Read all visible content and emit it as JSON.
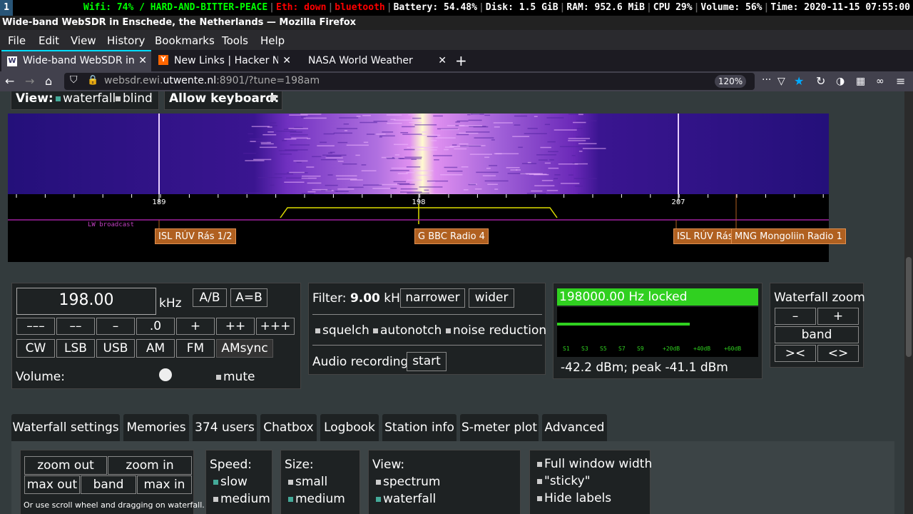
{
  "statusbar": {
    "workspace": "1",
    "items": [
      {
        "text": "Wifi:  74% / HARD-AND-BITTER-PEACE",
        "color": "#00ff00"
      },
      {
        "text": "Eth: down",
        "color": "#ff0000"
      },
      {
        "text": "bluetooth",
        "color": "#ff0000"
      },
      {
        "text": "Battery: 54.48%",
        "color": "#ffffff"
      },
      {
        "text": "Disk: 1.5 GiB",
        "color": "#ffffff"
      },
      {
        "text": "RAM: 952.6 MiB",
        "color": "#ffffff"
      },
      {
        "text": "CPU 29%",
        "color": "#ffffff"
      },
      {
        "text": "Volume: 56%",
        "color": "#ffffff"
      },
      {
        "text": "Time: 2020-11-15 07:55:00",
        "color": "#ffffff"
      }
    ]
  },
  "window_title": "Wide-band WebSDR in Enschede, the Netherlands — Mozilla Firefox",
  "menu": [
    "File",
    "Edit",
    "View",
    "History",
    "Bookmarks",
    "Tools",
    "Help"
  ],
  "tabs": [
    {
      "label": "Wide-band WebSDR in Enschede",
      "active": true
    },
    {
      "label": "New Links | Hacker News",
      "active": false
    },
    {
      "label": "NASA World Weather",
      "active": false
    }
  ],
  "url": {
    "prefix": "websdr.ewi.",
    "domain": "utwente.nl",
    "suffix": ":8901/?tune=198am",
    "zoom": "120%"
  },
  "view": {
    "label": "View:",
    "opt1": "waterfall",
    "opt2": "blind",
    "keyboard_label": "Allow keyboard:"
  },
  "scale": {
    "ticks": [
      "189",
      "198",
      "207"
    ],
    "band": "LW broadcast"
  },
  "stations": [
    "ISL RÚV Rás 1/2",
    "G BBC Radio 4",
    "ISL RÚV Rás",
    "MNG Mongoliin Radio 1"
  ],
  "tuning": {
    "frequency": "198.00",
    "unit": "kHz",
    "ab": "A/B",
    "aeqb": "A=B",
    "steps": [
      "–––",
      "––",
      "–",
      ".0",
      "+",
      "++",
      "+++"
    ],
    "modes": [
      "CW",
      "LSB",
      "USB",
      "AM",
      "FM",
      "AMsync"
    ],
    "volume_label": "Volume:",
    "mute": "mute",
    "volume_level": 0.64
  },
  "filter": {
    "label": "Filter:",
    "value": "9.00",
    "unit": "kHz",
    "narrower": "narrower",
    "wider": "wider",
    "squelch": "squelch",
    "autonotch": "autonotch",
    "noise": "noise reduction",
    "recording_label": "Audio recording",
    "start": "start"
  },
  "smeter": {
    "locked": "198000.00 Hz locked",
    "scale": [
      "S1",
      "S3",
      "S5",
      "S7",
      "S9",
      "+20dB",
      "+40dB",
      "+60dB"
    ],
    "reading": "-42.2 dBm; peak  -41.1 dBm",
    "level": 0.66
  },
  "wfzoom": {
    "title": "Waterfall zoom",
    "minus": "–",
    "plus": "+",
    "band": "band",
    "in": "><",
    "out": "<>"
  },
  "bottom_tabs": [
    "Waterfall settings",
    "Memories",
    "374 users",
    "Chatbox",
    "Logbook",
    "Station info",
    "S-meter plot",
    "Advanced"
  ],
  "wf_settings": {
    "zoom_out": "zoom out",
    "zoom_in": "zoom in",
    "max_out": "max out",
    "band": "band",
    "max_in": "max in",
    "hint": "Or use scroll wheel and dragging on waterfall.",
    "speed_label": "Speed:",
    "speed1": "slow",
    "speed2": "medium",
    "size_label": "Size:",
    "size1": "small",
    "size2": "medium",
    "view_label": "View:",
    "view1": "spectrum",
    "view2": "waterfall",
    "opt1": "Full window width",
    "opt2": "\"sticky\"",
    "opt3": "Hide labels"
  }
}
